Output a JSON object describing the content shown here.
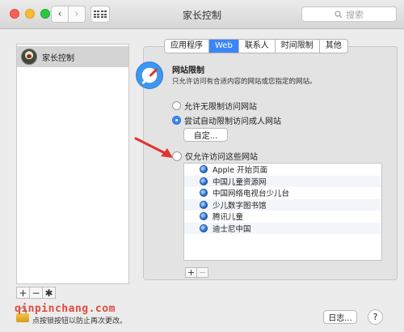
{
  "window": {
    "title": "家长控制"
  },
  "search": {
    "placeholder": "搜索"
  },
  "nav": {
    "back": "‹",
    "forward": "›"
  },
  "sidebar": {
    "items": [
      {
        "label": "家长控制"
      }
    ],
    "tools": {
      "add": "+",
      "remove": "−",
      "settings": "✱"
    }
  },
  "tabs": [
    {
      "label": "应用程序"
    },
    {
      "label": "Web",
      "active": true
    },
    {
      "label": "联系人"
    },
    {
      "label": "时间限制"
    },
    {
      "label": "其他"
    }
  ],
  "web": {
    "title": "网站限制",
    "description": "只允许访问有合适内容的网站或您指定的网站。",
    "options": [
      {
        "label": "允许无限制访问网站",
        "selected": false
      },
      {
        "label": "尝试自动限制访问成人网站",
        "selected": true
      },
      {
        "label": "仅允许访问这些网站",
        "selected": false
      }
    ],
    "custom_button": "自定...",
    "sites": [
      "Apple 开始页面",
      "中国儿童资源网",
      "中国网络电视台少儿台",
      "少儿数字图书馆",
      "腾讯儿童",
      "迪士尼中国"
    ],
    "list_tools": {
      "add": "+",
      "remove": "−"
    }
  },
  "footer": {
    "lock_text": "点按锁按钮以防止再次更改。",
    "log_button": "日志...",
    "help": "?",
    "watermark": "qinpinchang.com"
  },
  "colors": {
    "accent": "#3b86f7",
    "arrow": "#e0342f",
    "watermark": "#e23a2a"
  }
}
